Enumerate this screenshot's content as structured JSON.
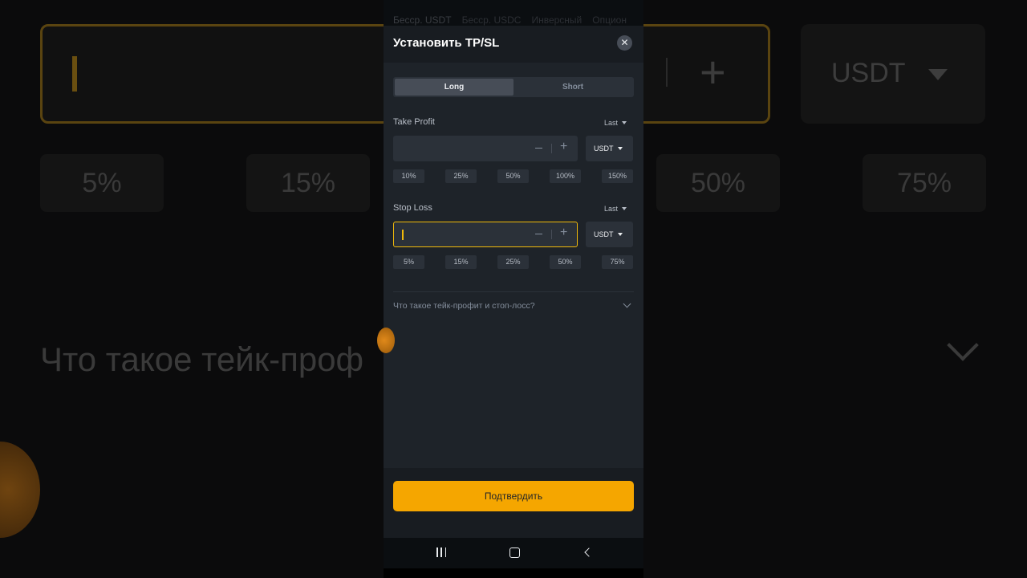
{
  "background": {
    "input_currency": "USDT",
    "percent_chips": [
      "5%",
      "15%",
      "50%",
      "75%"
    ],
    "question": "Что такое тейк-проф"
  },
  "behind_tabs": [
    "Бесср. USDT",
    "Бесср. USDC",
    "Инверсный",
    "Опцион"
  ],
  "modal": {
    "title": "Установить TP/SL",
    "close_icon": "close-icon",
    "sides": {
      "long": "Long",
      "short": "Short",
      "selected": "Long"
    },
    "take_profit": {
      "label": "Take Profit",
      "trigger": "Last",
      "value": "",
      "currency": "USDT",
      "percents": [
        "10%",
        "25%",
        "50%",
        "100%",
        "150%"
      ]
    },
    "stop_loss": {
      "label": "Stop Loss",
      "trigger": "Last",
      "value": "",
      "currency": "USDT",
      "percents": [
        "5%",
        "15%",
        "25%",
        "50%",
        "75%"
      ]
    },
    "faq": "Что такое тейк-профит и стоп-лосс?",
    "confirm": "Подтвердить"
  },
  "colors": {
    "accent": "#f5a600",
    "modal_bg": "#1e2329",
    "input_bg": "#2b3139"
  }
}
